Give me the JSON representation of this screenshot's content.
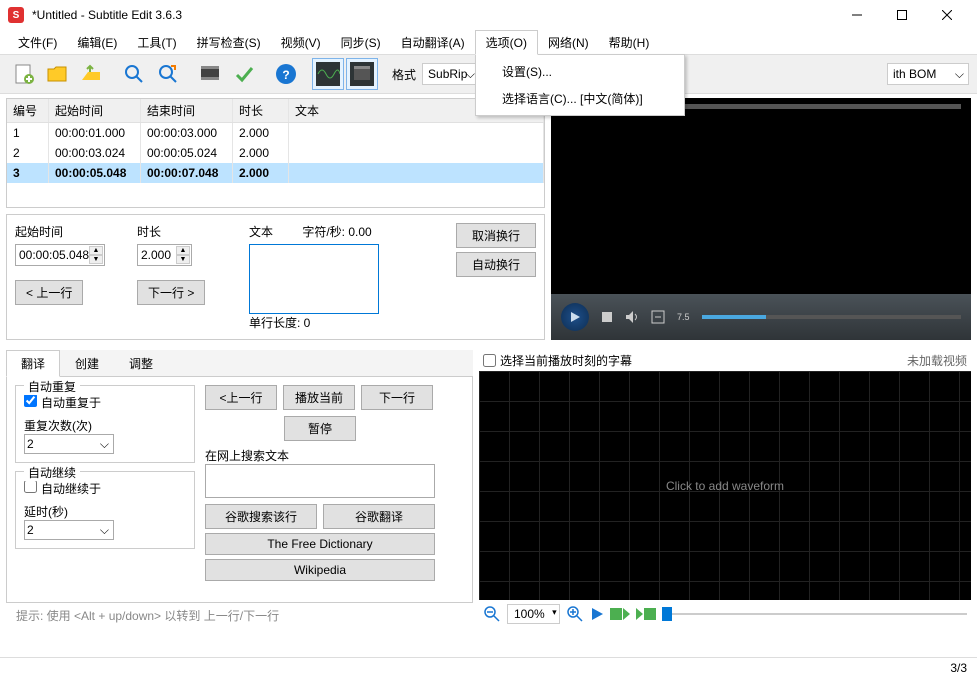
{
  "window": {
    "title": "*Untitled - Subtitle Edit 3.6.3"
  },
  "menu": {
    "items": [
      "文件(F)",
      "编辑(E)",
      "工具(T)",
      "拼写检查(S)",
      "视频(V)",
      "同步(S)",
      "自动翻译(A)",
      "选项(O)",
      "网络(N)",
      "帮助(H)"
    ],
    "open_index": 7,
    "dropdown": [
      "设置(S)...",
      "选择语言(C)... [中文(简体)]"
    ]
  },
  "toolbar": {
    "format_label": "格式",
    "format_value": "SubRip",
    "encoding_value": "ith BOM"
  },
  "table": {
    "headers": [
      "编号",
      "起始时间",
      "结束时间",
      "时长",
      "文本"
    ],
    "rows": [
      {
        "num": "1",
        "start": "00:00:01.000",
        "end": "00:00:03.000",
        "dur": "2.000",
        "text": ""
      },
      {
        "num": "2",
        "start": "00:00:03.024",
        "end": "00:00:05.024",
        "dur": "2.000",
        "text": ""
      },
      {
        "num": "3",
        "start": "00:00:05.048",
        "end": "00:00:07.048",
        "dur": "2.000",
        "text": ""
      }
    ],
    "selected": 2
  },
  "edit": {
    "start_label": "起始时间",
    "dur_label": "时长",
    "text_label": "文本",
    "cps_label": "字符/秒: 0.00",
    "start_value": "00:00:05.048",
    "dur_value": "2.000",
    "prev": "< 上一行",
    "next": "下一行 >",
    "unbreak": "取消换行",
    "autobreak": "自动换行",
    "linelen": "单行长度: 0"
  },
  "video": {
    "time": "7.5"
  },
  "tabs": {
    "items": [
      "翻译",
      "创建",
      "调整"
    ],
    "active": 0
  },
  "translate": {
    "autorep_title": "自动重复",
    "autorep_check": "自动重复于",
    "repcount_label": "重复次数(次)",
    "repcount_value": "2",
    "autocont_title": "自动继续",
    "autocont_check": "自动继续于",
    "delay_label": "延时(秒)",
    "delay_value": "2",
    "prev": "<上一行",
    "playcur": "播放当前",
    "next": "下一行",
    "pause": "暂停",
    "search_label": "在网上搜索文本",
    "google_row": "谷歌搜索该行",
    "google_trans": "谷歌翻译",
    "freedict": "The Free Dictionary",
    "wiki": "Wikipedia"
  },
  "wave": {
    "check_label": "选择当前播放时刻的字幕",
    "status": "未加载视频",
    "placeholder": "Click to add waveform",
    "zoom": "100%"
  },
  "hint": "提示: 使用 <Alt + up/down> 以转到 上一行/下一行",
  "status": "3/3"
}
